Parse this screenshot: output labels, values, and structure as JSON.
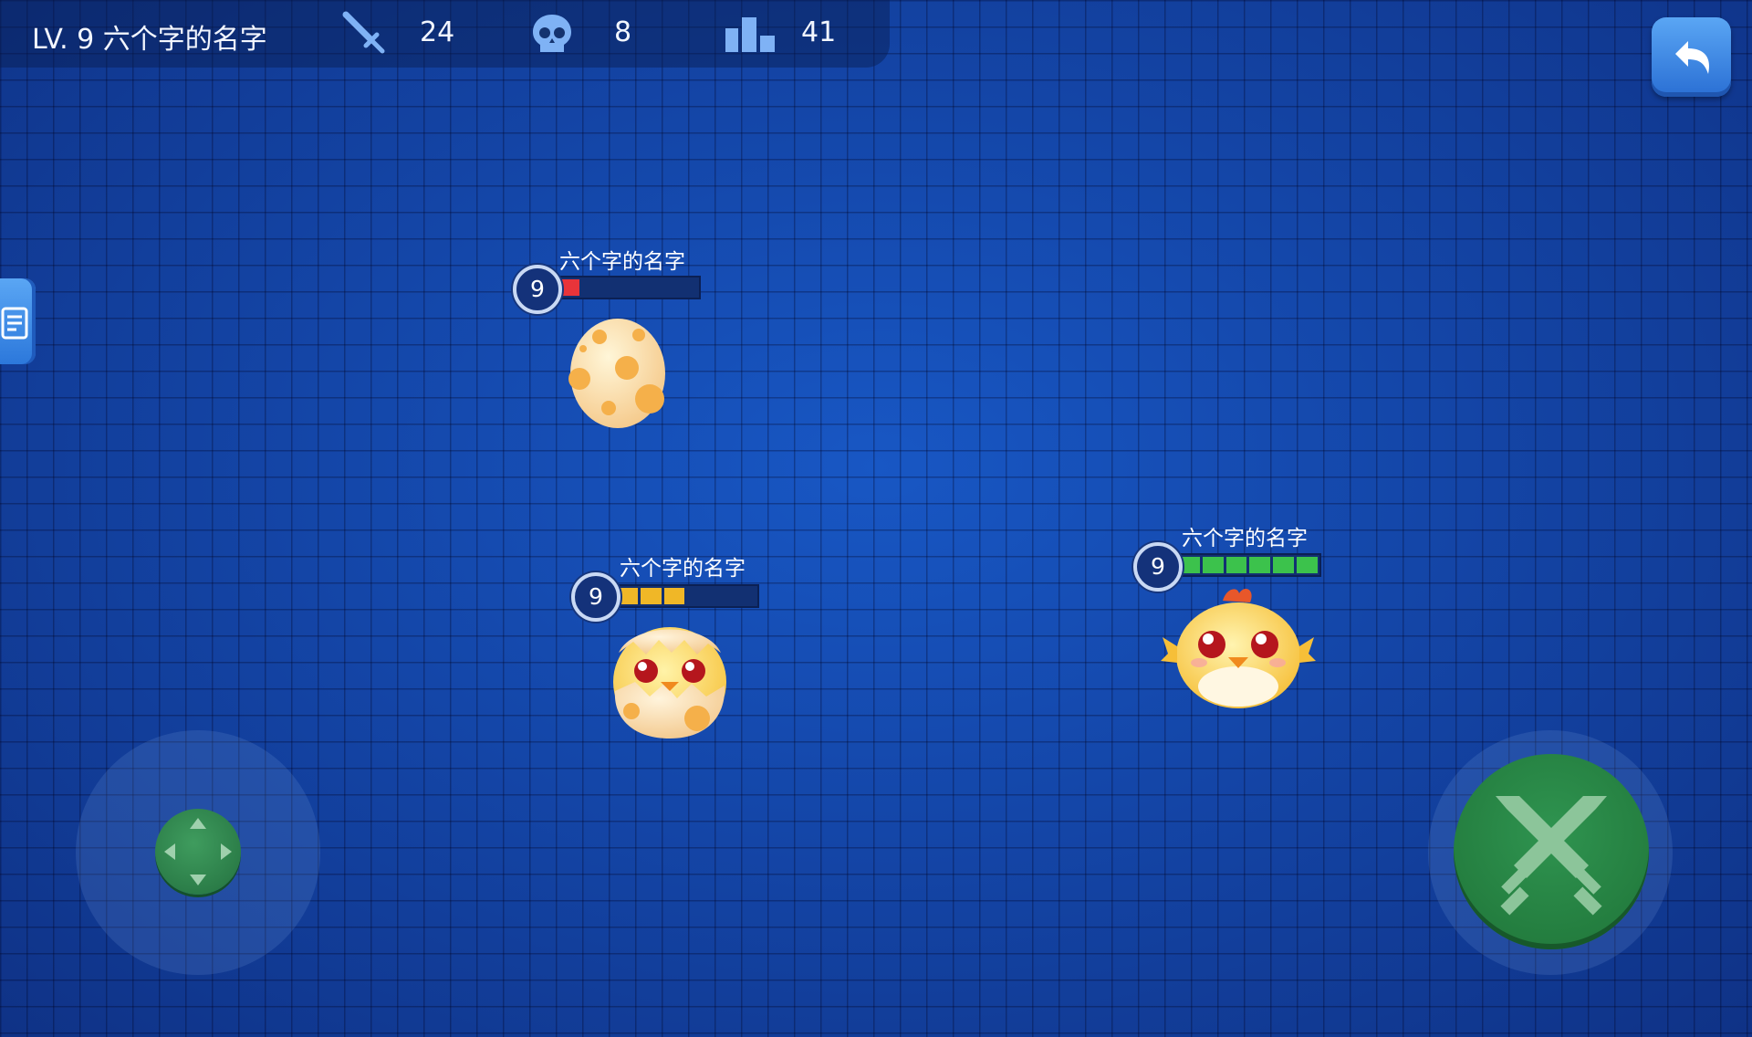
{
  "hud": {
    "player": "LV. 9 六个字的名字",
    "stats": [
      {
        "icon": "sword-icon",
        "value": "24"
      },
      {
        "icon": "skull-icon",
        "value": "8"
      },
      {
        "icon": "rank-bars-icon",
        "value": "41"
      }
    ]
  },
  "back_button": {
    "icon": "back-arrow-icon"
  },
  "side_tab": {
    "icon": "notes-icon"
  },
  "characters": [
    {
      "name": "六个字的名字",
      "level": "9",
      "form": "egg",
      "hp_segments_filled": 1,
      "hp_segments_total": 6,
      "hp_color": "#e8343a"
    },
    {
      "name": "六个字的名字",
      "level": "9",
      "form": "hatching-chick",
      "hp_segments_filled": 3,
      "hp_segments_total": 6,
      "hp_color": "#f0b727"
    },
    {
      "name": "六个字的名字",
      "level": "9",
      "form": "chick",
      "hp_segments_filled": 6,
      "hp_segments_total": 6,
      "hp_color": "#3cc24c"
    }
  ],
  "controls": {
    "joystick": {
      "icon": "dpad-arrows-icon"
    },
    "attack_button": {
      "icon": "crossed-swords-icon"
    }
  }
}
